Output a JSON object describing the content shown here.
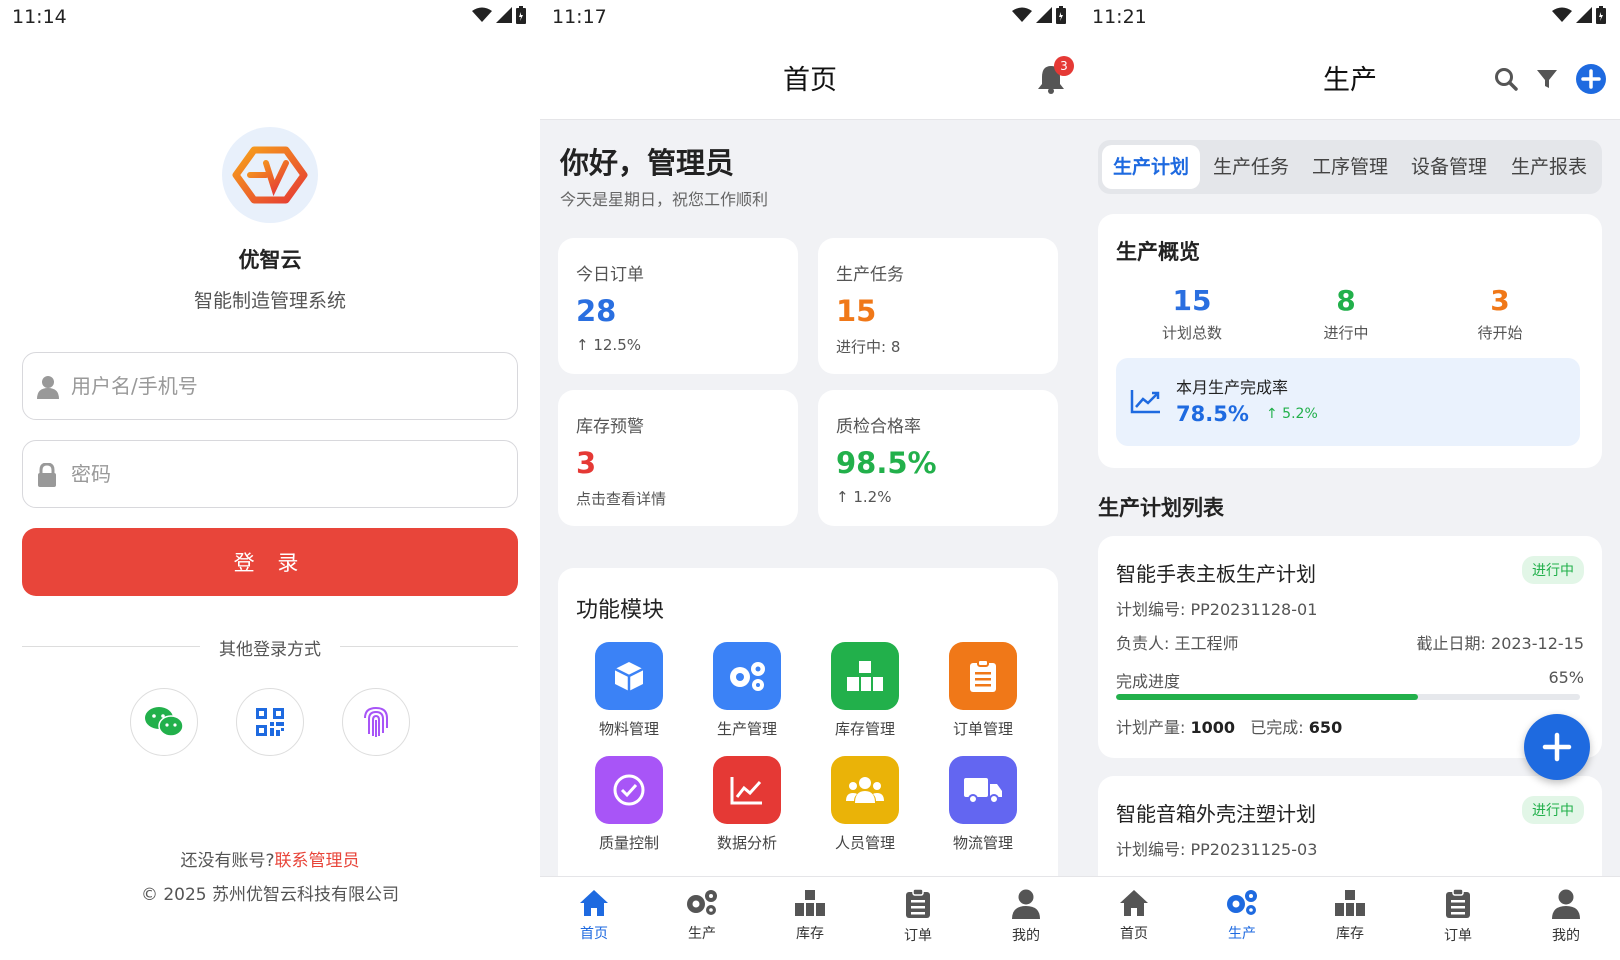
{
  "login": {
    "time": "11:14",
    "app_name": "优智云",
    "app_subtitle": "智能制造管理系统",
    "username_placeholder": "用户名/手机号",
    "password_placeholder": "密码",
    "login_button": "登 录",
    "other_login": "其他登录方式",
    "social": [
      "wechat-icon",
      "qrcode-icon",
      "fingerprint-icon"
    ],
    "no_account": "还没有账号?",
    "contact_admin": "联系管理员",
    "copyright": "© 2025 苏州优智云科技有限公司"
  },
  "home": {
    "time": "11:17",
    "title": "首页",
    "notification_count": "3",
    "greeting": "你好，管理员",
    "greeting_sub": "今天是星期日，祝您工作顺利",
    "stats": [
      {
        "label": "今日订单",
        "value": "28",
        "sub": "↑ 12.5%"
      },
      {
        "label": "生产任务",
        "value": "15",
        "sub": "进行中: 8"
      },
      {
        "label": "库存预警",
        "value": "3",
        "sub": "点击查看详情"
      },
      {
        "label": "质检合格率",
        "value": "98.5%",
        "sub": "↑ 1.2%"
      }
    ],
    "modules_title": "功能模块",
    "modules": [
      {
        "label": "物料管理",
        "color": "#3b82f6"
      },
      {
        "label": "生产管理",
        "color": "#3b82f6"
      },
      {
        "label": "库存管理",
        "color": "#22b04b"
      },
      {
        "label": "订单管理",
        "color": "#f07818"
      },
      {
        "label": "质量控制",
        "color": "#a855f7"
      },
      {
        "label": "数据分析",
        "color": "#e53935"
      },
      {
        "label": "人员管理",
        "color": "#eab308"
      },
      {
        "label": "物流管理",
        "color": "#6366f1"
      }
    ]
  },
  "production": {
    "time": "11:21",
    "title": "生产",
    "tabs": [
      "生产计划",
      "生产任务",
      "工序管理",
      "设备管理",
      "生产报表"
    ],
    "overview_title": "生产概览",
    "overview": [
      {
        "value": "15",
        "label": "计划总数"
      },
      {
        "value": "8",
        "label": "进行中"
      },
      {
        "value": "3",
        "label": "待开始"
      }
    ],
    "rate_title": "本月生产完成率",
    "rate_value": "78.5%",
    "rate_change": "↑ 5.2%",
    "list_title": "生产计划列表",
    "plans": [
      {
        "name": "智能手表主板生产计划",
        "status": "进行中",
        "code_label": "计划编号:",
        "code": "PP20231128-01",
        "owner_label": "负责人:",
        "owner": "王工程师",
        "deadline_label": "截止日期:",
        "deadline": "2023-12-15",
        "progress_label": "完成进度",
        "progress_text": "65%",
        "progress": 0.65,
        "planned_label": "计划产量:",
        "planned": "1000",
        "done_label": "已完成:",
        "done": "650"
      },
      {
        "name": "智能音箱外壳注塑计划",
        "status": "进行中",
        "code_label": "计划编号:",
        "code": "PP20231125-03"
      }
    ]
  },
  "tabbar": [
    "首页",
    "生产",
    "库存",
    "订单",
    "我的"
  ],
  "colors": {
    "primary": "#1e6ae0",
    "accent_red": "#e8453a",
    "success": "#22b04b"
  }
}
